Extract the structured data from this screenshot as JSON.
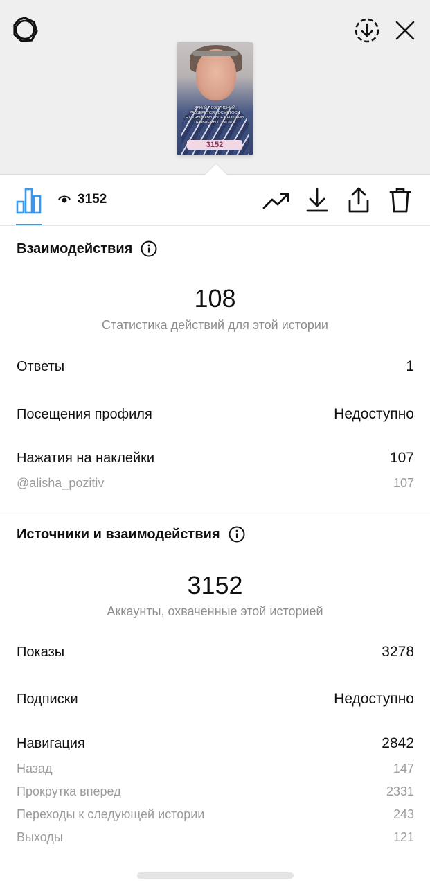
{
  "story_preview": {
    "caption": "ЯРКИЙ ПОЗИТИВНЫЙ РАЗБЕРЕТСЯ КОСМЕТОСИ НУЖНЫЙ УВИТ ВСЕ ПРОШЕНИ ПРОБЛЕМЫ ОТ КОЖИ",
    "sticker_text": "3152"
  },
  "tabbar": {
    "views_count": "3152"
  },
  "interactions": {
    "title": "Взаимодействия",
    "total": "108",
    "subtitle": "Статистика действий для этой истории",
    "rows": [
      {
        "label": "Ответы",
        "value": "1"
      },
      {
        "label": "Посещения профиля",
        "value": "Недоступно"
      },
      {
        "label": "Нажатия на наклейки",
        "value": "107"
      }
    ],
    "sub_rows": [
      {
        "label": "@alisha_pozitiv",
        "value": "107"
      }
    ]
  },
  "discovery": {
    "title": "Источники и взаимодействия",
    "total": "3152",
    "subtitle": "Аккаунты, охваченные этой историей",
    "rows": [
      {
        "label": "Показы",
        "value": "3278"
      },
      {
        "label": "Подписки",
        "value": "Недоступно"
      },
      {
        "label": "Навигация",
        "value": "2842"
      }
    ],
    "sub_rows": [
      {
        "label": "Назад",
        "value": "147"
      },
      {
        "label": "Прокрутка вперед",
        "value": "2331"
      },
      {
        "label": "Переходы к следующей истории",
        "value": "243"
      },
      {
        "label": "Выходы",
        "value": "121"
      }
    ]
  },
  "colors": {
    "accent": "#3897f0",
    "muted_text": "#8e8e8e",
    "top_background": "#efefef"
  },
  "icons": [
    "settings-icon",
    "download-circle-icon",
    "close-icon",
    "bar-chart-icon",
    "eye-icon",
    "trend-icon",
    "download-icon",
    "share-icon",
    "trash-icon",
    "info-icon"
  ]
}
